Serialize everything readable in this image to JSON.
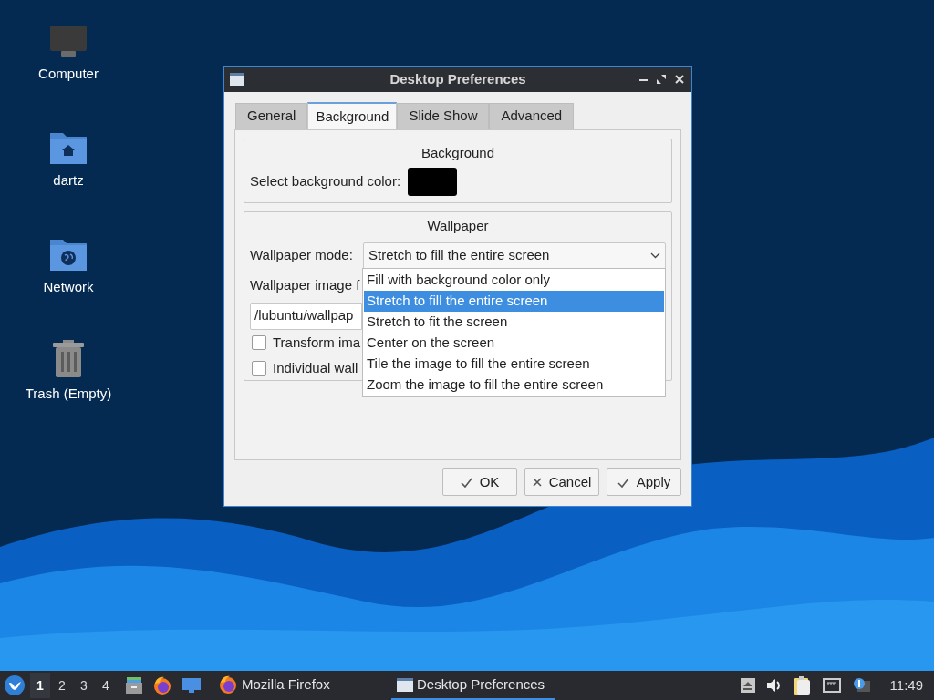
{
  "desktop_icons": [
    {
      "label": "Computer",
      "kind": "computer"
    },
    {
      "label": "dartz",
      "kind": "home"
    },
    {
      "label": "Network",
      "kind": "network"
    },
    {
      "label": "Trash (Empty)",
      "kind": "trash"
    }
  ],
  "window": {
    "title": "Desktop Preferences",
    "tabs": [
      {
        "label": "General",
        "selected": false
      },
      {
        "label": "Background",
        "selected": true
      },
      {
        "label": "Slide Show",
        "selected": false
      },
      {
        "label": "Advanced",
        "selected": false
      }
    ],
    "background_group": {
      "title": "Background",
      "color_label": "Select background color:",
      "color": "#000000"
    },
    "wallpaper_group": {
      "title": "Wallpaper",
      "mode_label": "Wallpaper mode:",
      "mode_value": "Stretch to fill the entire screen",
      "image_label": "Wallpaper image f",
      "image_path": "/lubuntu/wallpap",
      "checkboxes": [
        {
          "label": "Transform ima",
          "checked": false
        },
        {
          "label": "Individual wall",
          "checked": false
        }
      ],
      "dropdown": {
        "options": [
          {
            "label": "Fill with background color only",
            "selected": false
          },
          {
            "label": "Stretch to fill the entire screen",
            "selected": true
          },
          {
            "label": "Stretch to fit the screen",
            "selected": false
          },
          {
            "label": "Center on the screen",
            "selected": false
          },
          {
            "label": "Tile the image to fill the entire screen",
            "selected": false
          },
          {
            "label": "Zoom the image to fill the entire screen",
            "selected": false
          }
        ]
      }
    },
    "buttons": [
      {
        "label": "OK",
        "kind": "ok"
      },
      {
        "label": "Cancel",
        "kind": "cancel"
      },
      {
        "label": "Apply",
        "kind": "apply"
      }
    ]
  },
  "taskbar": {
    "workspaces": [
      {
        "label": "1",
        "selected": true
      },
      {
        "label": "2",
        "selected": false
      },
      {
        "label": "3",
        "selected": false
      },
      {
        "label": "4",
        "selected": false
      }
    ],
    "launchers": [
      {
        "kind": "files"
      },
      {
        "kind": "firefox"
      },
      {
        "kind": "desktop"
      }
    ],
    "tasks": [
      {
        "label": "Mozilla Firefox",
        "kind": "firefox",
        "selected": false
      },
      {
        "label": "Desktop Preferences",
        "kind": "window",
        "selected": true
      }
    ],
    "tray": [
      {
        "kind": "eject"
      },
      {
        "kind": "volume"
      },
      {
        "kind": "clipboard"
      },
      {
        "kind": "network"
      },
      {
        "kind": "notification"
      }
    ],
    "clock": "11:49"
  }
}
